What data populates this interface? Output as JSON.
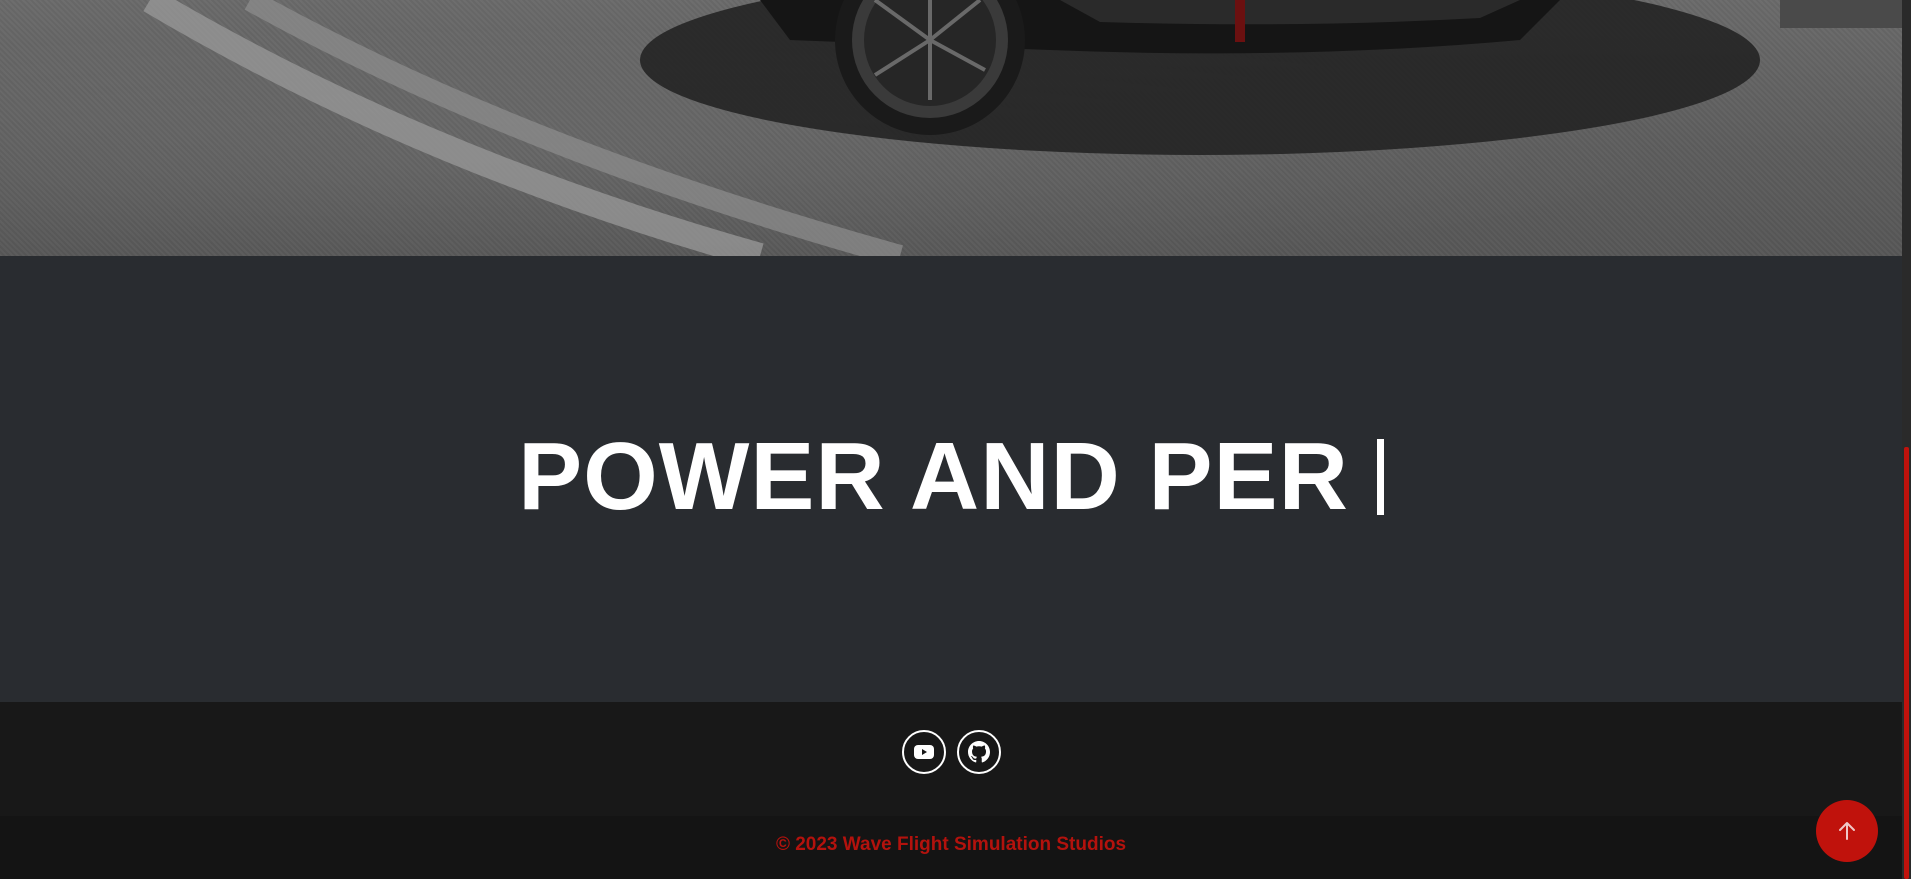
{
  "hero": {
    "image_description_icon": "car-on-asphalt-photo"
  },
  "typing_section": {
    "text": "POWER AND PER",
    "cursor": "|"
  },
  "social": {
    "links": [
      {
        "name": "youtube",
        "icon": "youtube-icon"
      },
      {
        "name": "github",
        "icon": "github-icon"
      }
    ]
  },
  "footer": {
    "copyright": "© 2023 Wave Flight Simulation Studios"
  },
  "back_to_top": {
    "icon": "arrow-up-icon"
  },
  "colors": {
    "accent": "#c0120c",
    "section_bg": "#292c30",
    "social_bg": "#181818",
    "footer_bg": "#141414",
    "copyright_text": "#b3120d"
  }
}
